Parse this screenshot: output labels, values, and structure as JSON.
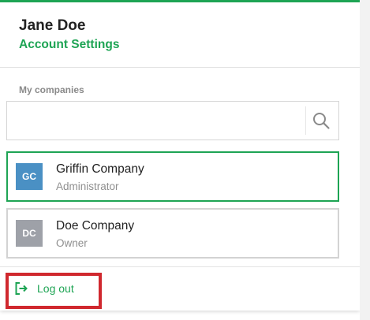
{
  "user": {
    "name": "Jane Doe",
    "account_link": "Account Settings"
  },
  "companies_section": {
    "label": "My companies",
    "search": {
      "value": "",
      "placeholder": "",
      "icon": "search-icon"
    },
    "items": [
      {
        "initials": "GC",
        "name": "Griffin Company",
        "role": "Administrator",
        "selected": true,
        "avatar_color": "#4a90c4"
      },
      {
        "initials": "DC",
        "name": "Doe Company",
        "role": "Owner",
        "selected": false,
        "avatar_color": "#9ea1a8"
      }
    ]
  },
  "footer": {
    "logout_label": "Log out",
    "logout_icon": "logout-icon"
  },
  "colors": {
    "accent": "#1ea454",
    "highlight": "#d0282e"
  }
}
